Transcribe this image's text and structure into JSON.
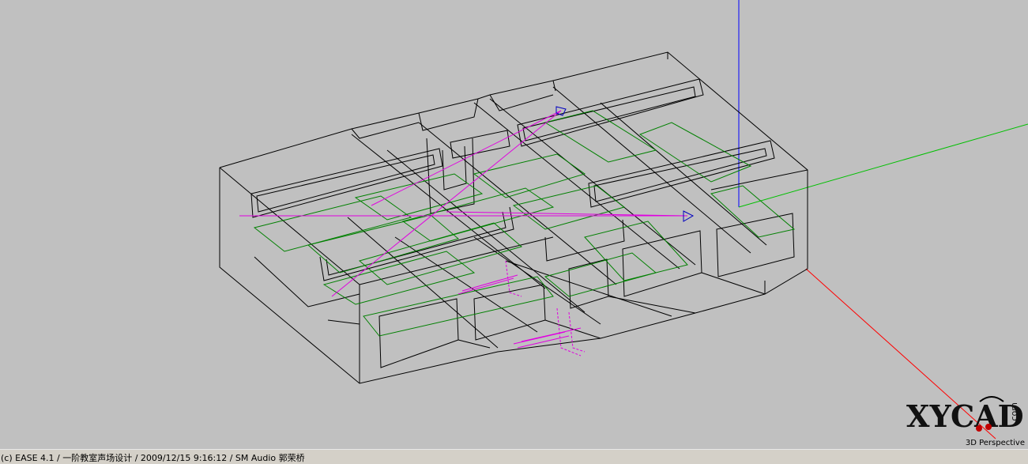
{
  "viewport": {
    "view_label": "3D Perspective",
    "colors": {
      "background": "#c0c0c0",
      "wireframe": "#000000",
      "audience_areas": "#008000",
      "speakers": "#e000e0",
      "axis_x": "#ff0000",
      "axis_y": "#00c000",
      "axis_z": "#0000ff"
    }
  },
  "logo": {
    "text": "XYCAD",
    "suffix": ".com"
  },
  "status_bar": {
    "text": "(c) EASE 4.1  / 一阶教室声场设计  / 2009/12/15 9:16:12 / SM Audio 郭荣桥"
  }
}
